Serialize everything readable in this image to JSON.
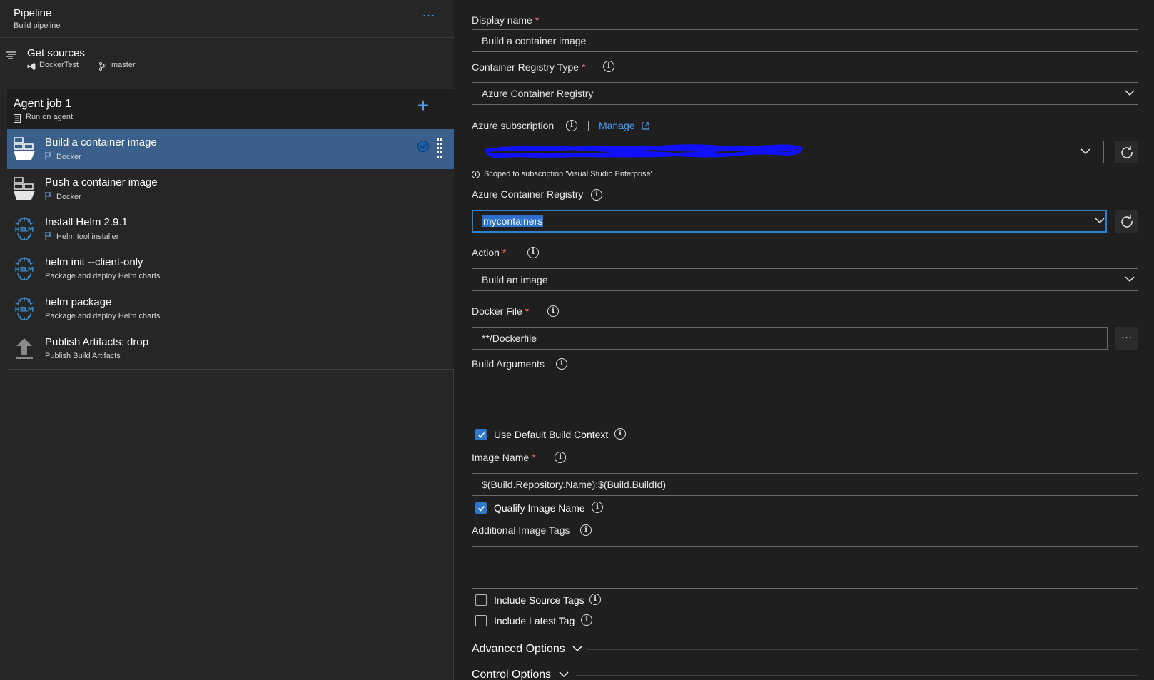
{
  "pipeline": {
    "title": "Pipeline",
    "subtitle": "Build pipeline",
    "more_label": "..."
  },
  "get_sources": {
    "title": "Get sources",
    "repo": "DockerTest",
    "branch": "master"
  },
  "agent_job": {
    "title": "Agent job 1",
    "subtitle": "Run on agent",
    "add_label": "+"
  },
  "tasks": [
    {
      "name": "Build a container image",
      "subtitle": "Docker",
      "icon": "docker-icon",
      "selected": true
    },
    {
      "name": "Push a container image",
      "subtitle": "Docker",
      "icon": "docker-icon",
      "selected": false
    },
    {
      "name": "Install Helm 2.9.1",
      "subtitle": "Helm tool installer",
      "icon": "helm-icon",
      "selected": false
    },
    {
      "name": "helm init --client-only",
      "subtitle": "Package and deploy Helm charts",
      "icon": "helm-icon",
      "selected": false
    },
    {
      "name": "helm package",
      "subtitle": "Package and deploy Helm charts",
      "icon": "helm-icon",
      "selected": false
    },
    {
      "name": "Publish Artifacts: drop",
      "subtitle": "Publish Build Artifacts",
      "icon": "upload-arrow-icon",
      "selected": false
    }
  ],
  "form": {
    "display_name": {
      "label": "Display name",
      "required": "*",
      "value": "Build a container image"
    },
    "registry_type": {
      "label": "Container Registry Type",
      "required": "*",
      "value": "Azure Container Registry"
    },
    "subscription": {
      "label": "Azure subscription",
      "separator": "|",
      "manage": "Manage",
      "value": "",
      "scope_note": "Scoped to subscription 'Visual Studio Enterprise'"
    },
    "acr": {
      "label": "Azure Container Registry",
      "value": "mycontainers"
    },
    "action": {
      "label": "Action",
      "required": "*",
      "value": "Build an image"
    },
    "docker_file": {
      "label": "Docker File",
      "required": "*",
      "value": "**/Dockerfile",
      "browse": "..."
    },
    "build_args": {
      "label": "Build Arguments",
      "value": ""
    },
    "default_context": {
      "label": "Use Default Build Context",
      "checked": true
    },
    "image_name": {
      "label": "Image Name",
      "required": "*",
      "value": "$(Build.Repository.Name):$(Build.BuildId)"
    },
    "qualify": {
      "label": "Qualify Image Name",
      "checked": true
    },
    "additional_tags": {
      "label": "Additional Image Tags",
      "value": ""
    },
    "include_source_tags": {
      "label": "Include Source Tags",
      "checked": false
    },
    "include_latest_tag": {
      "label": "Include Latest Tag",
      "checked": false
    }
  },
  "sections": {
    "advanced": "Advanced Options",
    "control": "Control Options"
  },
  "colors": {
    "accent": "#4aa0f5",
    "selected_row": "#3a5f8a",
    "required": "#f06a6a",
    "checkbox": "#2f78c9",
    "redaction": "#1010ff"
  }
}
